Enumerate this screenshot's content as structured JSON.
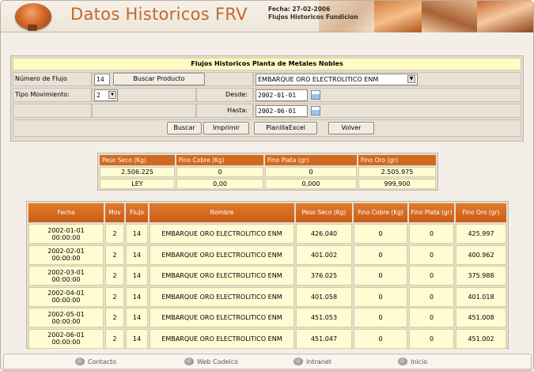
{
  "header": {
    "title": "Datos Historicos FRV",
    "fecha_label": "Fecha:",
    "fecha_value": "27-02-2006",
    "subtitle": "Flujos Historicos Fundicion"
  },
  "form": {
    "title": "Flujos Historicos Planta de Metales Nobles",
    "numero_flujo_label": "Número de Flujo",
    "numero_flujo_value": "14",
    "buscar_producto_label": "Buscar Producto",
    "producto_selected": "EMBARQUE ORO ELECTROLITICO ENM",
    "tipo_movimiento_label": "Tipo Movimiento:",
    "tipo_movimiento_value": "2",
    "desde_label": "Desde:",
    "desde_value": "2002-01-01",
    "hasta_label": "Hasta:",
    "hasta_value": "2002-06-01",
    "buttons": {
      "buscar": "Buscar",
      "imprimir": "Imprimir",
      "planilla": "PlanillaExcel",
      "volver": "Volver"
    }
  },
  "summary": {
    "headers": [
      "Peso Seco (Kg)",
      "Fino Cobre (Kg)",
      "Fino Plata (gr)",
      "Fino Oro (gr)"
    ],
    "row1": [
      "2.506.225",
      "0",
      "0",
      "2.505.975"
    ],
    "row2": [
      "LEY",
      "0,00",
      "0,000",
      "999,900"
    ]
  },
  "table": {
    "headers": [
      "Fecha",
      "Mov",
      "Flujo",
      "Nombre",
      "Peso Seco (Kg)",
      "Fino Cobre (Kg)",
      "Fino Plata (gr)",
      "Fino Oro (gr)"
    ],
    "rows": [
      {
        "fecha": "2002-01-01",
        "hora": "00:00:00",
        "mov": "2",
        "flujo": "14",
        "nombre": "EMBARQUE ORO ELECTROLITICO ENM",
        "peso": "426.040",
        "cobre": "0",
        "plata": "0",
        "oro": "425.997"
      },
      {
        "fecha": "2002-02-01",
        "hora": "00:00:00",
        "mov": "2",
        "flujo": "14",
        "nombre": "EMBARQUE ORO ELECTROLITICO ENM",
        "peso": "401.002",
        "cobre": "0",
        "plata": "0",
        "oro": "400.962"
      },
      {
        "fecha": "2002-03-01",
        "hora": "00:00:00",
        "mov": "2",
        "flujo": "14",
        "nombre": "EMBARQUE ORO ELECTROLITICO ENM",
        "peso": "376.025",
        "cobre": "0",
        "plata": "0",
        "oro": "375.988"
      },
      {
        "fecha": "2002-04-01",
        "hora": "00:00:00",
        "mov": "2",
        "flujo": "14",
        "nombre": "EMBARQUE ORO ELECTROLITICO ENM",
        "peso": "401.058",
        "cobre": "0",
        "plata": "0",
        "oro": "401.018"
      },
      {
        "fecha": "2002-05-01",
        "hora": "00:00:00",
        "mov": "2",
        "flujo": "14",
        "nombre": "EMBARQUE ORO ELECTROLITICO ENM",
        "peso": "451.053",
        "cobre": "0",
        "plata": "0",
        "oro": "451.008"
      },
      {
        "fecha": "2002-06-01",
        "hora": "00:00:00",
        "mov": "2",
        "flujo": "14",
        "nombre": "EMBARQUE ORO ELECTROLITICO ENM",
        "peso": "451.047",
        "cobre": "0",
        "plata": "0",
        "oro": "451.002"
      }
    ]
  },
  "footer": {
    "items": [
      "Contacto",
      "Web Codelco",
      "Intranet",
      "Inicio"
    ],
    "icon": "globe-icon"
  },
  "colors": {
    "title_orange": "#c1692c",
    "header_orange": "#cf6a1f",
    "cell_yellow": "#fffbd2",
    "title_yellow": "#fffbc4"
  }
}
